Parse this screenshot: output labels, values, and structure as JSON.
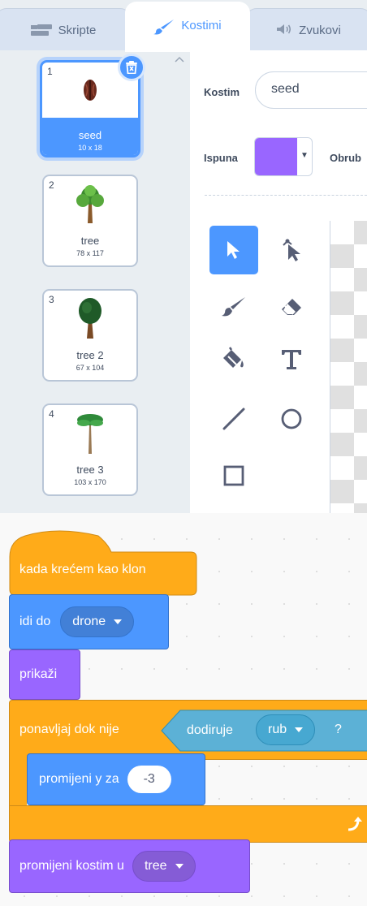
{
  "tabs": [
    {
      "label": "Skripte",
      "icon": "code-icon",
      "active": false
    },
    {
      "label": "Kostimi",
      "icon": "brush-icon",
      "active": true
    },
    {
      "label": "Zvukovi",
      "icon": "speaker-icon",
      "active": false
    }
  ],
  "costumes": [
    {
      "number": "1",
      "name": "seed",
      "size": "10 x 18",
      "selected": true
    },
    {
      "number": "2",
      "name": "tree",
      "size": "78 x 117",
      "selected": false
    },
    {
      "number": "3",
      "name": "tree 2",
      "size": "67 x 104",
      "selected": false
    },
    {
      "number": "4",
      "name": "tree 3",
      "size": "103 x 170",
      "selected": false
    }
  ],
  "editor": {
    "costume_label": "Kostim",
    "costume_name": "seed",
    "fill_label": "Ispuna",
    "fill_color": "#9966ff",
    "outline_label": "Obrub",
    "tools": [
      "select-tool",
      "reshape-tool",
      "brush-tool",
      "eraser-tool",
      "fill-tool",
      "text-tool",
      "line-tool",
      "circle-tool",
      "rectangle-tool"
    ],
    "active_tool": "select-tool"
  },
  "script": {
    "hat": "kada krećem kao klon",
    "goto_label": "idi do",
    "goto_target": "drone",
    "show": "prikaži",
    "repeat_until": "ponavljaj dok nije",
    "touching_label": "dodiruje",
    "touching_target": "rub",
    "touching_q": "?",
    "change_y_label": "promijeni y za",
    "change_y_value": "-3",
    "switch_costume_label": "promijeni kostim u",
    "switch_costume_target": "tree"
  },
  "colors": {
    "events": "#ffab19",
    "motion": "#4c97ff",
    "looks": "#9966ff",
    "sensing": "#5cb1d6",
    "accent": "#4c97ff"
  }
}
